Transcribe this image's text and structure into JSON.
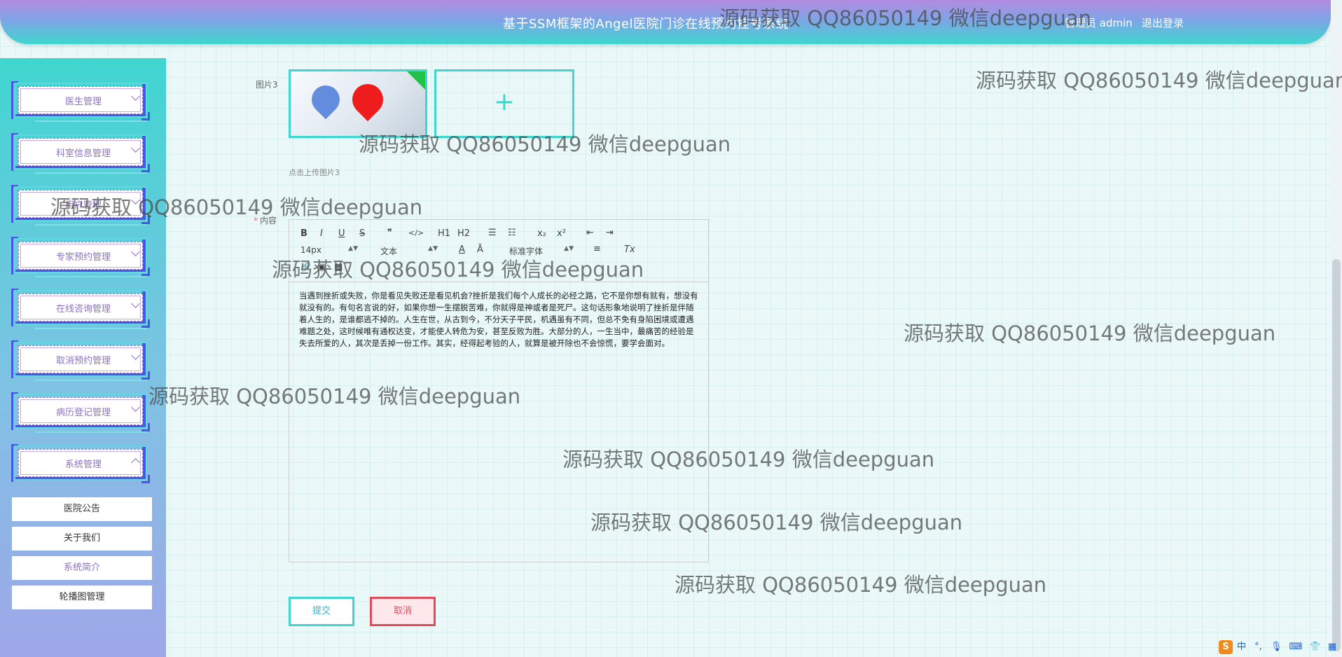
{
  "header": {
    "title": "基于SSM框架的Angel医院门诊在线预约挂号系统",
    "user": "管理员 admin",
    "logout": "退出登录"
  },
  "sidebar": {
    "menus": [
      {
        "label": "医生管理"
      },
      {
        "label": "科室信息管理"
      },
      {
        "label": "用户管理"
      },
      {
        "label": "专家预约管理"
      },
      {
        "label": "在线咨询管理"
      },
      {
        "label": "取消预约管理"
      },
      {
        "label": "病历登记管理"
      },
      {
        "label": "系统管理"
      }
    ],
    "submenus": [
      {
        "label": "医院公告"
      },
      {
        "label": "关于我们"
      },
      {
        "label": "系统简介"
      },
      {
        "label": "轮播图管理"
      }
    ]
  },
  "form": {
    "image_label": "图片3",
    "upload_hint": "点击上传图片3",
    "content_label": "内容",
    "required_mark": "*",
    "upload_plus": "+"
  },
  "editor": {
    "toolbar": {
      "bold": "B",
      "italic": "I",
      "underline": "U",
      "strike": "S",
      "quote": "❞",
      "code": "</>",
      "h1": "H1",
      "h2": "H2",
      "ordered_list": "☰",
      "bullet_list": "☷",
      "subscript": "x₂",
      "superscript": "x²",
      "outdent": "⇤",
      "indent": "⇥",
      "font_size": "14px",
      "text_type": "文本",
      "font_color": "A",
      "bg_color": "Ā",
      "font_family": "标准字体",
      "align": "≡",
      "clear_format": "Tx",
      "link": "🔗",
      "image": "▣",
      "video": "▦"
    },
    "content": "当遇到挫折或失败，你是看见失败还是看见机会?挫折是我们每个人成长的必经之路，它不是你想有就有，想没有就没有的。有句名言说的好，如果你想一生摆脱苦难，你就得是神或者是死尸。这句话形象地说明了挫折是伴随着人生的，是谁都逃不掉的。人生在世，从古到今，不分天子平民，机遇虽有不同，但总不免有身陷困境或遭遇难题之处，这时候唯有通权达变，才能使人转危为安，甚至反败为胜。大部分的人，一生当中，最痛苦的经验是失去所爱的人，其次是丢掉一份工作。其实，经得起考验的人，就算是被开除也不会惊慌，要学会面对。"
  },
  "buttons": {
    "submit": "提交",
    "cancel": "取消"
  },
  "watermark": "源码获取 QQ86050149 微信deepguan",
  "tray": {
    "ime": "S",
    "lang": "中",
    "punct": "°,"
  }
}
